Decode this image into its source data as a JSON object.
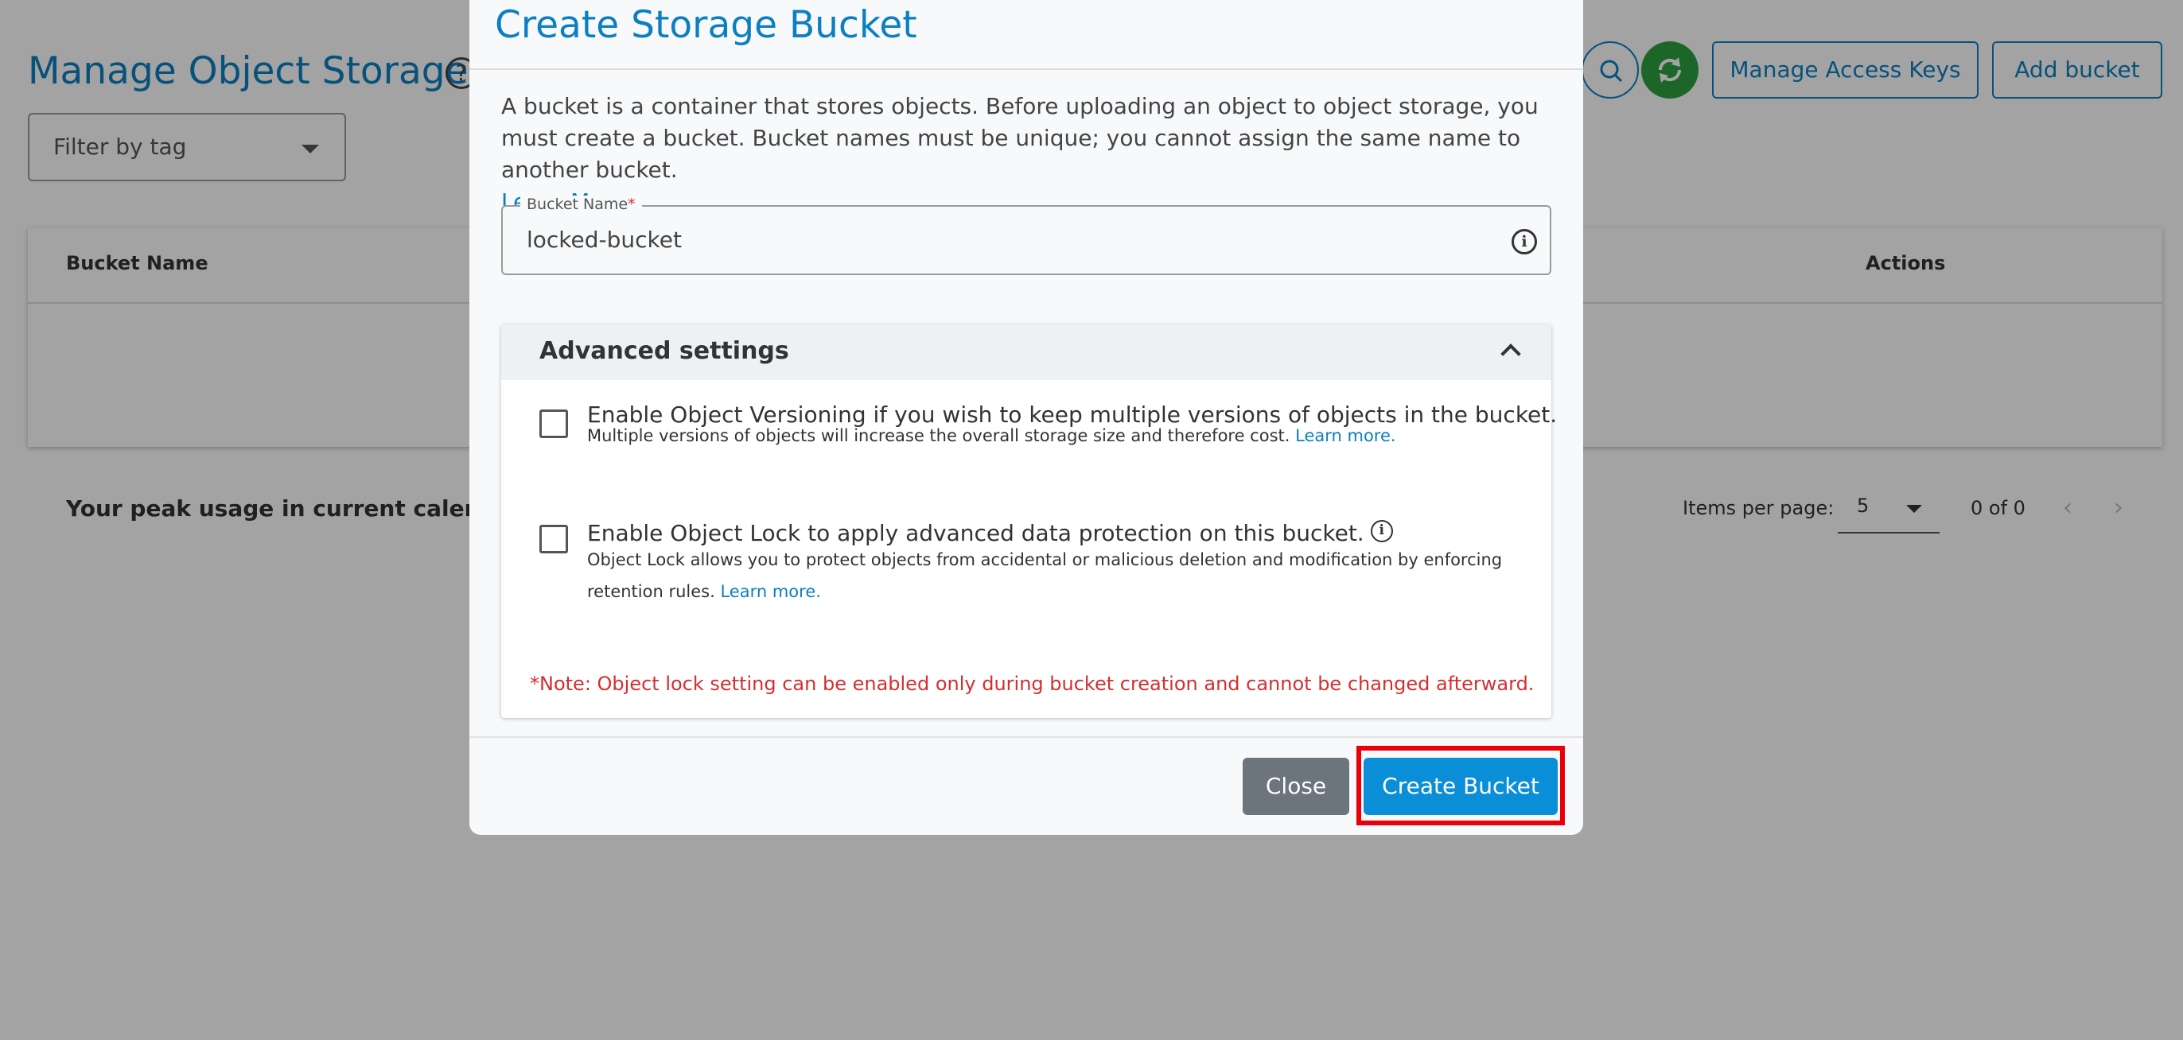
{
  "page": {
    "title": "Manage Object Storage",
    "help_glyph": "?",
    "filter_placeholder": "Filter by tag",
    "manage_keys_label": "Manage Access Keys",
    "add_bucket_label": "Add bucket",
    "table_headers": {
      "bucket_name": "Bucket Name",
      "actions": "Actions"
    },
    "usage_text": "Your peak usage in current calendar m",
    "items_per_page_label": "Items per page:",
    "items_per_page_value": "5",
    "page_count": "0 of 0",
    "prev_glyph": "‹",
    "next_glyph": "›"
  },
  "modal": {
    "title": "Create Storage Bucket",
    "description": "A bucket is a container that stores objects. Before uploading an object to object storage, you must create a bucket. Bucket names must be unique; you cannot assign the same name to another bucket.",
    "learn_more": "Learn More.",
    "bucket_name_label": "Bucket Name",
    "required_mark": "*",
    "bucket_name_value": "locked-bucket",
    "info_glyph": "i",
    "advanced_title": "Advanced settings",
    "versioning": {
      "title": "Enable Object Versioning if you wish to keep multiple versions of objects in the bucket.",
      "desc": "Multiple versions of objects will increase the overall storage size and therefore cost.",
      "link": "Learn more.",
      "checked": false
    },
    "object_lock": {
      "title": "Enable Object Lock to apply advanced data protection on this bucket.",
      "desc": "Object Lock allows you to protect objects from accidental or malicious deletion and modification by enforcing retention rules.",
      "link": "Learn more.",
      "checked": false
    },
    "note": "*Note: Object lock setting can be enabled only during bucket creation and cannot be changed afterward.",
    "close_label": "Close",
    "create_label": "Create Bucket"
  },
  "colors": {
    "accent": "#0b7fc1",
    "primary_button": "#0b8ed8",
    "secondary_button": "#6c757d",
    "refresh_button": "#2ea043",
    "warning_text": "#d32f2f",
    "highlight": "#e8000b"
  },
  "icons": [
    "help-icon",
    "search-icon",
    "refresh-icon",
    "chevron-down-icon",
    "info-icon",
    "chevron-up-icon",
    "chevron-left-icon",
    "chevron-right-icon"
  ]
}
